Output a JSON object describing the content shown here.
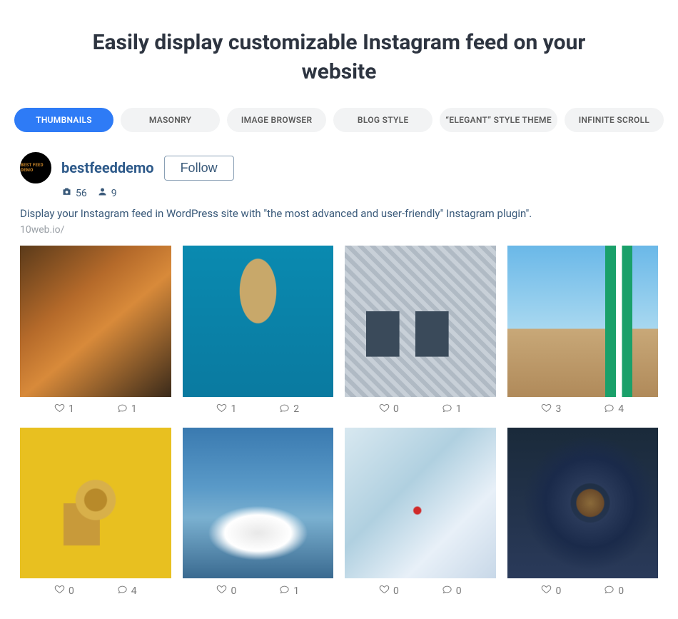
{
  "title": "Easily display customizable Instagram feed on your website",
  "tabs": [
    {
      "label": "THUMBNAILS",
      "active": true
    },
    {
      "label": "MASONRY",
      "active": false
    },
    {
      "label": "IMAGE BROWSER",
      "active": false
    },
    {
      "label": "BLOG STYLE",
      "active": false
    },
    {
      "label": "“ELEGANT” STYLE THEME",
      "active": false
    },
    {
      "label": "INFINITE SCROLL",
      "active": false
    }
  ],
  "profile": {
    "username": "bestfeeddemo",
    "follow_label": "Follow",
    "posts_count": "56",
    "followers_count": "9",
    "bio": "Display your Instagram feed in WordPress site with \"the most advanced and user-friendly\" Instagram plugin\".",
    "link": "10web.io/"
  },
  "posts": [
    {
      "likes": "1",
      "comments": "1"
    },
    {
      "likes": "1",
      "comments": "2"
    },
    {
      "likes": "0",
      "comments": "1"
    },
    {
      "likes": "3",
      "comments": "4"
    },
    {
      "likes": "0",
      "comments": "4"
    },
    {
      "likes": "0",
      "comments": "1"
    },
    {
      "likes": "0",
      "comments": "0"
    },
    {
      "likes": "0",
      "comments": "0"
    }
  ]
}
